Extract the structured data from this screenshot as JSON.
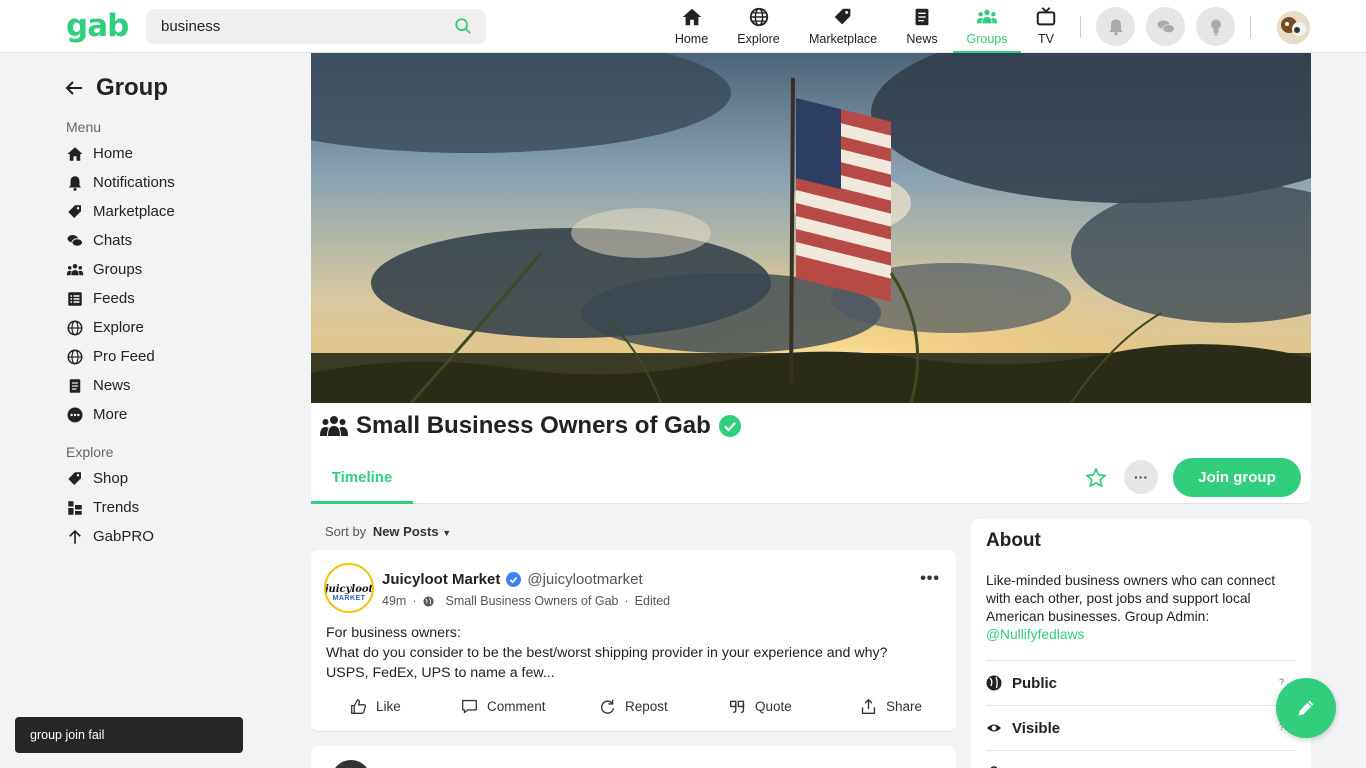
{
  "topbar": {
    "logo": "gab",
    "search_value": "business",
    "nav": [
      {
        "label": "Home",
        "icon": "home-icon"
      },
      {
        "label": "Explore",
        "icon": "globe-icon"
      },
      {
        "label": "Marketplace",
        "icon": "tag-icon"
      },
      {
        "label": "News",
        "icon": "document-icon"
      },
      {
        "label": "Groups",
        "icon": "users-icon",
        "active": true
      },
      {
        "label": "TV",
        "icon": "tv-icon"
      }
    ]
  },
  "sidebar": {
    "title": "Group",
    "menu_label": "Menu",
    "menu": [
      "Home",
      "Notifications",
      "Marketplace",
      "Chats",
      "Groups",
      "Feeds",
      "Explore",
      "Pro Feed",
      "News",
      "More"
    ],
    "explore_label": "Explore",
    "explore": [
      "Shop",
      "Trends",
      "GabPRO"
    ]
  },
  "group": {
    "name": "Small Business Owners of Gab",
    "tab": "Timeline",
    "join_label": "Join group",
    "more_label": "···"
  },
  "sort": {
    "label": "Sort by",
    "value": "New Posts"
  },
  "post": {
    "avatar_l1": "juicyloot",
    "avatar_l2": "MARKET",
    "author": "Juicyloot Market",
    "handle": "@juicylootmarket",
    "time": "49m",
    "group": "Small Business Owners of Gab",
    "edited": "Edited",
    "line1": "For business owners:",
    "line2": "What do you consider to be the best/worst shipping provider in your experience and why?",
    "line3": "USPS, FedEx, UPS to name a few...",
    "actions": {
      "like": "Like",
      "comment": "Comment",
      "repost": "Repost",
      "quote": "Quote",
      "share": "Share"
    }
  },
  "about": {
    "title": "About",
    "description": "Like-minded business owners who can connect with each other, post jobs and support local American businesses.  Group Admin:",
    "admin": "@Nullifyfedlaws",
    "public": "Public",
    "visible": "Visible"
  },
  "toast": "group join fail",
  "colors": {
    "accent": "#30ce7d",
    "verified": "#3b82f6"
  }
}
